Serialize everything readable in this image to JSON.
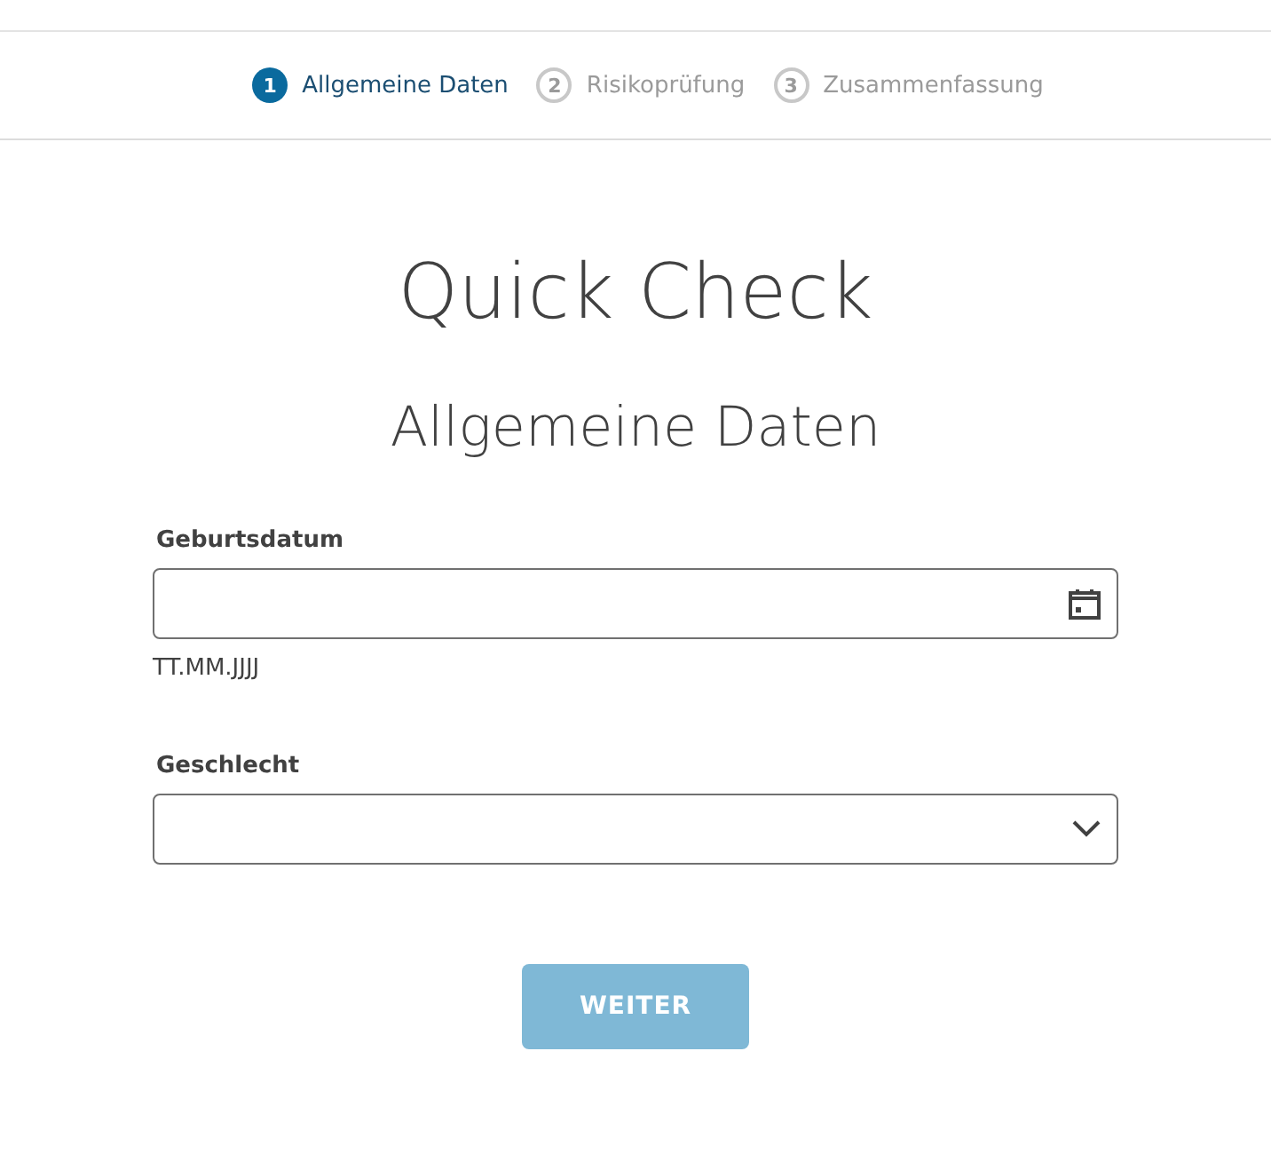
{
  "steps": [
    {
      "number": "1",
      "label": "Allgemeine Daten",
      "selected": true
    },
    {
      "number": "2",
      "label": "Risikoprüfung",
      "selected": false
    },
    {
      "number": "3",
      "label": "Zusammenfassung",
      "selected": false
    }
  ],
  "title": "Quick Check",
  "subtitle": "Allgemeine Daten",
  "fields": [
    {
      "kind": "date",
      "label": "Geburtsdatum",
      "hint": "TT.MM.JJJJ"
    },
    {
      "kind": "select",
      "label": "Geschlecht"
    }
  ],
  "button": {
    "label": "WEITER",
    "disabled": true
  }
}
